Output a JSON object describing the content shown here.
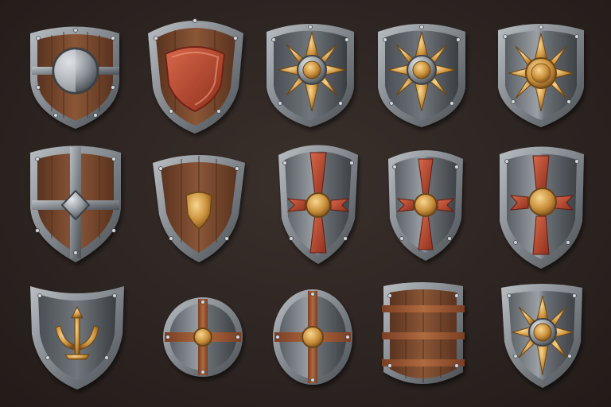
{
  "scene": {
    "title": "",
    "background_color": "#2e2623",
    "palette": {
      "iron": "#8c9196",
      "iron_dark": "#4c5156",
      "wood": "#7a4a30",
      "wood_dark": "#5a3320",
      "red": "#b6452e",
      "gold": "#d9a44e",
      "steel": "#6e7378"
    },
    "items": [
      {
        "id": "wood-shield-round-boss",
        "icon": "wooden-heater-shield-with-steel-boss-icon"
      },
      {
        "id": "wood-shield-red-inlay",
        "icon": "wooden-heater-shield-with-red-inlay-icon"
      },
      {
        "id": "steel-shield-star-1",
        "icon": "steel-shield-with-gold-star-icon"
      },
      {
        "id": "steel-shield-star-2",
        "icon": "steel-shield-with-gold-star-icon"
      },
      {
        "id": "steel-shield-star-3",
        "icon": "steel-shield-with-gold-star-icon"
      },
      {
        "id": "wood-shield-cross-bands",
        "icon": "wooden-shield-with-iron-cross-bands-icon"
      },
      {
        "id": "wood-shield-gold-crest",
        "icon": "wooden-shield-with-gold-crest-icon"
      },
      {
        "id": "steel-shield-red-cross-1",
        "icon": "steel-shield-with-red-cross-icon"
      },
      {
        "id": "steel-shield-red-cross-2",
        "icon": "steel-shield-with-red-cross-icon"
      },
      {
        "id": "steel-shield-red-cross-3",
        "icon": "steel-shield-with-red-cross-icon"
      },
      {
        "id": "steel-shield-trident",
        "icon": "steel-shield-with-gold-trident-icon"
      },
      {
        "id": "round-shield-cross-1",
        "icon": "round-steel-shield-with-copper-cross-icon"
      },
      {
        "id": "round-shield-cross-2",
        "icon": "round-steel-shield-with-copper-cross-icon"
      },
      {
        "id": "wood-tower-shield",
        "icon": "wooden-tower-shield-with-iron-bands-icon"
      },
      {
        "id": "steel-shield-star-4",
        "icon": "steel-shield-with-gold-star-icon"
      }
    ]
  }
}
